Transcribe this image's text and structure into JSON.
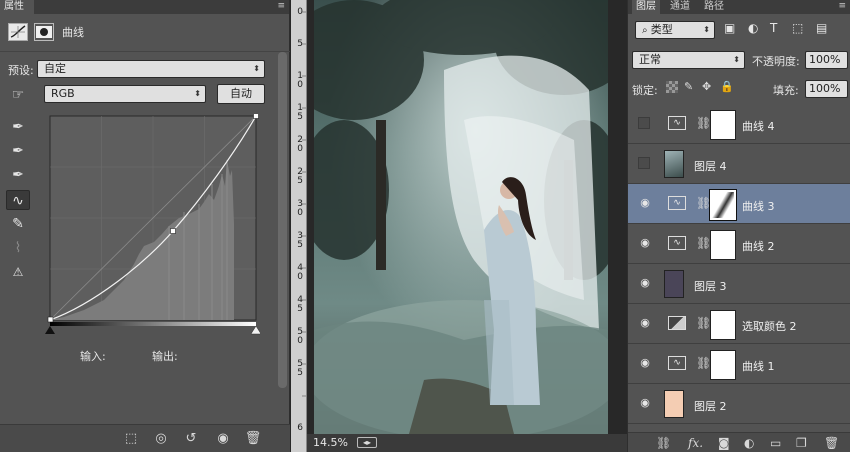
{
  "properties": {
    "tab_label": "属性",
    "title": "曲线",
    "preset_label": "预设:",
    "preset_value": "自定",
    "channel_value": "RGB",
    "auto_button": "自动",
    "input_label": "输入:",
    "output_label": "输出:"
  },
  "ruler": {
    "labels": [
      "0",
      "5",
      "1\n0",
      "1\n5",
      "2\n0",
      "2\n5",
      "3\n0",
      "3\n5",
      "4\n0",
      "4\n5",
      "5\n0",
      "5\n5",
      "6"
    ]
  },
  "canvas": {
    "zoom": "14.5%"
  },
  "layers_panel": {
    "tabs": [
      "图层",
      "通道",
      "路径"
    ],
    "filter_label": "类型",
    "blend_mode": "正常",
    "opacity_label": "不透明度:",
    "opacity_value": "100%",
    "lock_label": "锁定:",
    "fill_label": "填充:",
    "fill_value": "100%",
    "layers": [
      {
        "name": "曲线 4",
        "kind": "curves",
        "visible": false,
        "selected": false
      },
      {
        "name": "图层 4",
        "kind": "image",
        "visible": false,
        "selected": false
      },
      {
        "name": "曲线 3",
        "kind": "curves",
        "visible": true,
        "selected": true
      },
      {
        "name": "曲线 2",
        "kind": "curves",
        "visible": true,
        "selected": false
      },
      {
        "name": "图层 3",
        "kind": "solid",
        "visible": true,
        "selected": false,
        "color": "#4a4558"
      },
      {
        "name": "选取颜色 2",
        "kind": "selective",
        "visible": true,
        "selected": false
      },
      {
        "name": "曲线 1",
        "kind": "curves",
        "visible": true,
        "selected": false
      },
      {
        "name": "图层 2",
        "kind": "solid",
        "visible": true,
        "selected": false,
        "color": "#f4cdb3"
      }
    ]
  },
  "colors": {
    "panel": "#535353",
    "selection": "#6d7f9c",
    "dark": "#282828"
  }
}
